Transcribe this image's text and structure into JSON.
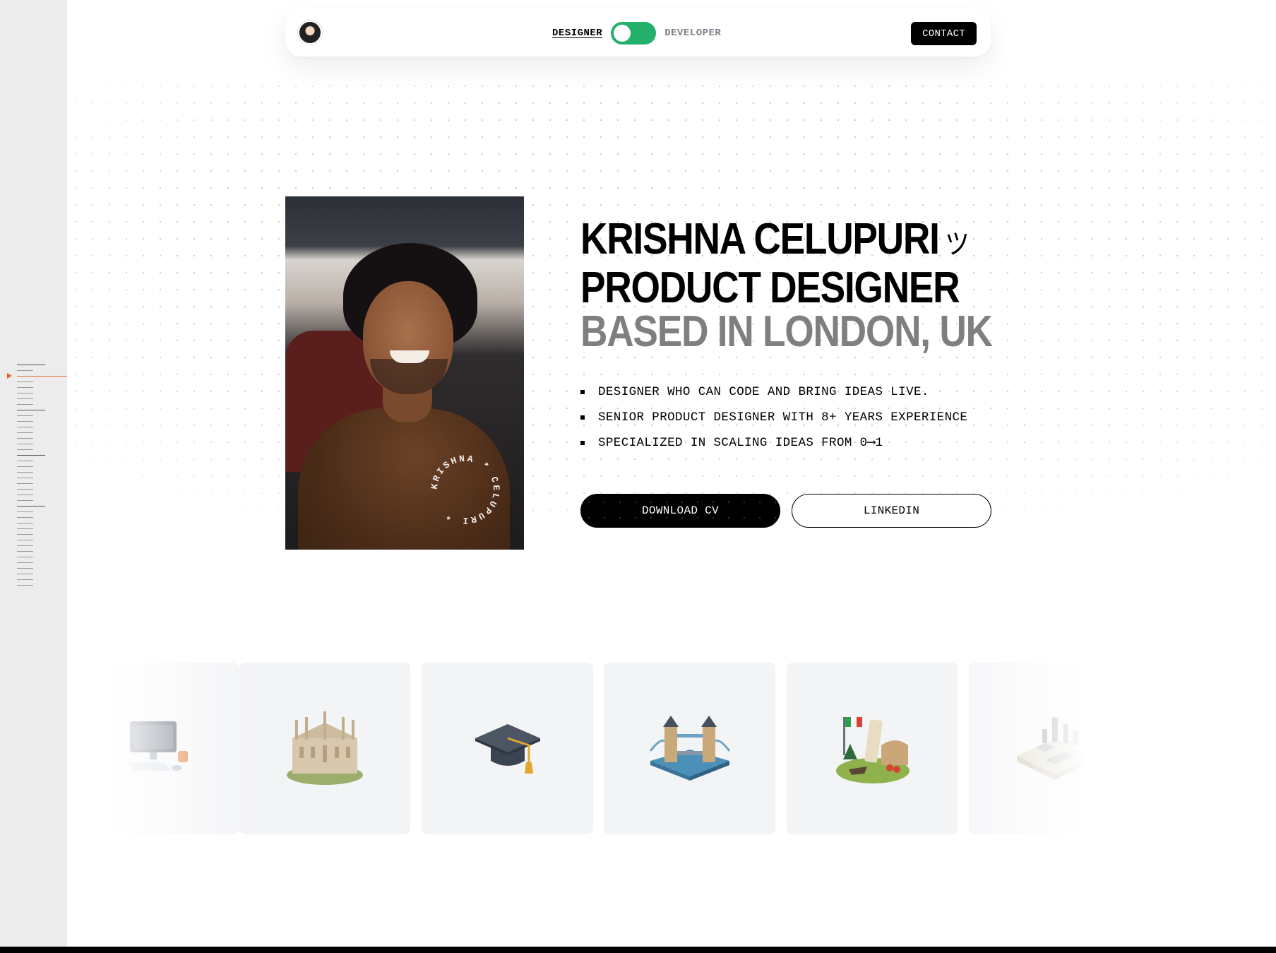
{
  "nav": {
    "avatar_alt": "avatar",
    "mode_left": "DESIGNER",
    "mode_right": "DEVELOPER",
    "toggle_state": "designer",
    "contact_label": "CONTACT"
  },
  "hero": {
    "name": "KRISHNA CELUPURI",
    "name_glyph": "ツ",
    "role": "PRODUCT DESIGNER",
    "location": "BASED IN LONDON, UK",
    "bullets": [
      "DESIGNER WHO CAN CODE AND BRING IDEAS LIVE.",
      "SENIOR PRODUCT DESIGNER WITH 8+ YEARS EXPERIENCE",
      "SPECIALIZED IN SCALING IDEAS FROM 0⟶1"
    ],
    "shirt_text": "KRISHNA * CELUPURI *",
    "cta_primary": "DOWNLOAD CV",
    "cta_secondary": "LINKEDIN"
  },
  "carousel": {
    "items": [
      {
        "icon": "computer-desk-icon"
      },
      {
        "icon": "milan-cathedral-icon"
      },
      {
        "icon": "graduation-cap-icon"
      },
      {
        "icon": "tower-bridge-icon"
      },
      {
        "icon": "italy-landmarks-icon"
      },
      {
        "icon": "chess-board-icon"
      }
    ]
  },
  "colors": {
    "accent_green": "#22b06a",
    "accent_orange": "#f0642a",
    "text": "#000000",
    "muted": "#7f7f7f"
  }
}
